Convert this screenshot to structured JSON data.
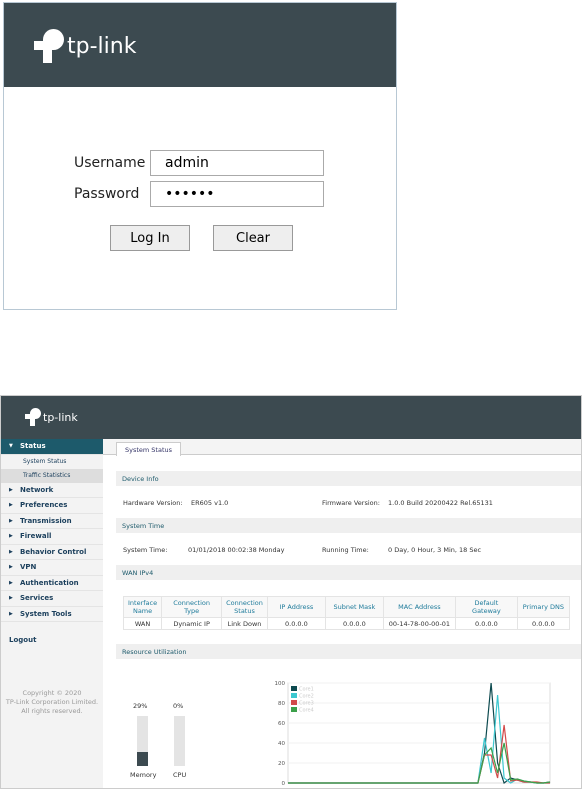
{
  "brand": "tp-link",
  "login": {
    "username_label": "Username",
    "username_value": "admin",
    "password_label": "Password",
    "password_value": "••••••",
    "login_button": "Log In",
    "clear_button": "Clear"
  },
  "sidebar": {
    "items": [
      {
        "label": "Status",
        "expanded": true,
        "children": [
          "System Status",
          "Traffic Statistics"
        ]
      },
      {
        "label": "Network"
      },
      {
        "label": "Preferences"
      },
      {
        "label": "Transmission"
      },
      {
        "label": "Firewall"
      },
      {
        "label": "Behavior Control"
      },
      {
        "label": "VPN"
      },
      {
        "label": "Authentication"
      },
      {
        "label": "Services"
      },
      {
        "label": "System Tools"
      }
    ],
    "logout": "Logout",
    "copyright": [
      "Copyright © 2020",
      "TP-Link Corporation Limited.",
      "All rights reserved."
    ]
  },
  "main": {
    "tab": "System Status",
    "device_info": {
      "title": "Device Info",
      "hw_label": "Hardware Version:",
      "hw_value": "ER605  v1.0",
      "fw_label": "Firmware Version:",
      "fw_value": "1.0.0 Build 20200422 Rel.65131"
    },
    "system_time": {
      "title": "System Time",
      "time_label": "System Time:",
      "time_value": "01/01/2018 00:02:38 Monday",
      "run_label": "Running Time:",
      "run_value": "0 Day, 0 Hour, 3 Min, 18 Sec"
    },
    "wan": {
      "title": "WAN IPv4",
      "headers": [
        "Interface Name",
        "Connection Type",
        "Connection Status",
        "IP Address",
        "Subnet Mask",
        "MAC Address",
        "Default Gateway",
        "Primary DNS"
      ],
      "rows": [
        [
          "WAN",
          "Dynamic IP",
          "Link Down",
          "0.0.0.0",
          "0.0.0.0",
          "00-14-78-00-00-01",
          "0.0.0.0",
          "0.0.0.0"
        ]
      ]
    },
    "resource": {
      "title": "Resource Utilization",
      "memory_label": "Memory",
      "memory_value": "29%",
      "memory_percent": 29,
      "cpu_label": "CPU",
      "cpu_value": "0%",
      "cpu_percent": 0
    }
  },
  "chart_data": {
    "type": "line",
    "ylim": [
      0,
      100
    ],
    "yticks": [
      "0",
      "20",
      "40",
      "60",
      "80",
      "100"
    ],
    "legend": "top-left",
    "series": [
      {
        "name": "Core1",
        "color": "#0d4a4f",
        "values": [
          0,
          0,
          0,
          0,
          0,
          0,
          0,
          0,
          0,
          0,
          0,
          0,
          0,
          0,
          0,
          0,
          0,
          0,
          0,
          0,
          0,
          0,
          0,
          0,
          0,
          0,
          0,
          0,
          0,
          0,
          30,
          100,
          20,
          0,
          5,
          3,
          1,
          1,
          0,
          0,
          1
        ]
      },
      {
        "name": "Core2",
        "color": "#3cc8d0",
        "values": [
          0,
          0,
          0,
          0,
          0,
          0,
          0,
          0,
          0,
          0,
          0,
          0,
          0,
          0,
          0,
          0,
          0,
          0,
          0,
          0,
          0,
          0,
          0,
          0,
          0,
          0,
          0,
          0,
          0,
          0,
          45,
          10,
          88,
          5,
          0,
          4,
          2,
          1,
          0,
          0,
          0
        ]
      },
      {
        "name": "Core3",
        "color": "#d24a4a",
        "values": [
          0,
          0,
          0,
          0,
          0,
          0,
          0,
          0,
          0,
          0,
          0,
          0,
          0,
          0,
          0,
          0,
          0,
          0,
          0,
          0,
          0,
          0,
          0,
          0,
          0,
          0,
          0,
          0,
          0,
          0,
          28,
          28,
          5,
          58,
          2,
          3,
          1,
          1,
          1,
          0,
          0
        ]
      },
      {
        "name": "Core4",
        "color": "#3ca04a",
        "values": [
          0,
          0,
          0,
          0,
          0,
          0,
          0,
          0,
          0,
          0,
          0,
          0,
          0,
          0,
          0,
          0,
          0,
          0,
          0,
          0,
          0,
          0,
          0,
          0,
          0,
          0,
          0,
          0,
          0,
          0,
          28,
          35,
          10,
          40,
          3,
          4,
          2,
          1,
          0,
          0,
          1
        ]
      }
    ]
  }
}
